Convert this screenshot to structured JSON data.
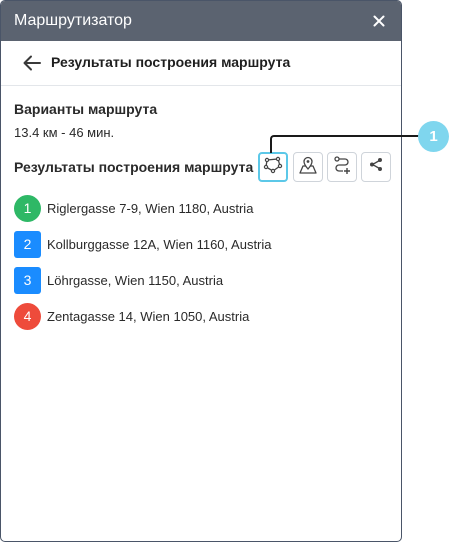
{
  "window": {
    "title": "Маршрутизатор"
  },
  "header": {
    "title": "Результаты построения маршрута"
  },
  "variants": {
    "label": "Варианты маршрута",
    "summary": "13.4 км - 46 мин."
  },
  "results": {
    "label": "Результаты построения маршрута"
  },
  "toolbar": [
    {
      "name": "polygon-icon",
      "active": true
    },
    {
      "name": "map-pin-icon",
      "active": false
    },
    {
      "name": "route-add-icon",
      "active": false
    },
    {
      "name": "share-icon",
      "active": false
    }
  ],
  "stops": [
    {
      "number": "1",
      "address": "Riglergasse 7-9, Wien 1180, Austria",
      "shape": "circle",
      "color": "#2eb866"
    },
    {
      "number": "2",
      "address": "Kollburggasse 12A, Wien 1160, Austria",
      "shape": "square",
      "color": "#1a8cff"
    },
    {
      "number": "3",
      "address": "Löhrgasse, Wien 1150, Austria",
      "shape": "square",
      "color": "#1a8cff"
    },
    {
      "number": "4",
      "address": "Zentagasse 14, Wien 1050, Austria",
      "shape": "circle",
      "color": "#ee4b3b"
    }
  ],
  "callout": {
    "number": "1",
    "color": "#7fd6ee"
  },
  "colors": {
    "titlebar": "#5b6370",
    "active_border": "#5cc8e8"
  }
}
